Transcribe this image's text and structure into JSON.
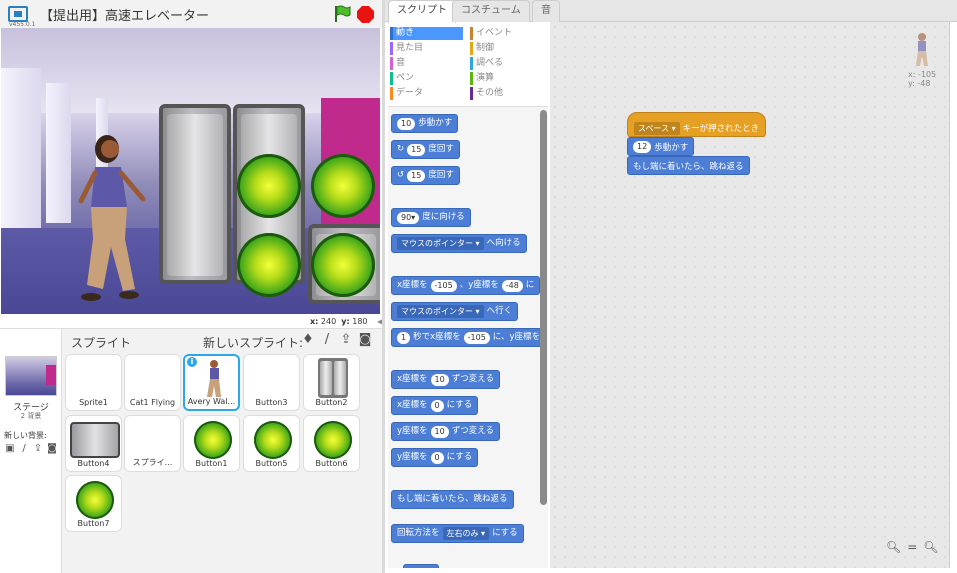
{
  "stage": {
    "version": "v455.0.1",
    "project_title": "【提出用】高速エレベーター",
    "mouse_x_label": "x:",
    "mouse_x": "240",
    "mouse_y_label": "y:",
    "mouse_y": "180"
  },
  "sprites_pane": {
    "header": "スプライト",
    "new_sprite_label": "新しいスプライト:",
    "stage_label": "ステージ",
    "stage_backdrops": "2 背景",
    "new_backdrop_label": "新しい背景:",
    "sprites": [
      {
        "name": "Sprite1",
        "thumb": "empty"
      },
      {
        "name": "Cat1 Flying",
        "thumb": "empty"
      },
      {
        "name": "Avery Wal...",
        "thumb": "character",
        "selected": true
      },
      {
        "name": "Button3",
        "thumb": "empty"
      },
      {
        "name": "Button2",
        "thumb": "door"
      },
      {
        "name": "Button4",
        "thumb": "grey"
      },
      {
        "name": "スプライ...",
        "thumb": "empty"
      },
      {
        "name": "Button1",
        "thumb": "green"
      },
      {
        "name": "Button5",
        "thumb": "green"
      },
      {
        "name": "Button6",
        "thumb": "green"
      },
      {
        "name": "Button7",
        "thumb": "green"
      }
    ]
  },
  "tabs": [
    {
      "label": "スクリプト",
      "active": true
    },
    {
      "label": "コスチューム",
      "active": false
    },
    {
      "label": "音",
      "active": false
    }
  ],
  "categories": [
    {
      "label": "動き",
      "color": "#4c97ff",
      "active": true
    },
    {
      "label": "見た目",
      "color": "#9966ff",
      "active": false
    },
    {
      "label": "音",
      "color": "#cf63cf",
      "active": false
    },
    {
      "label": "ペン",
      "color": "#0fbd8c",
      "active": false
    },
    {
      "label": "データ",
      "color": "#ff8c1a",
      "active": false
    },
    {
      "label": "イベント",
      "color": "#c88330",
      "active": false
    },
    {
      "label": "制御",
      "color": "#e1a91a",
      "active": false
    },
    {
      "label": "調べる",
      "color": "#2ca5e2",
      "active": false
    },
    {
      "label": "演算",
      "color": "#5cb712",
      "active": false
    },
    {
      "label": "その他",
      "color": "#632d99",
      "active": false
    }
  ],
  "palette": {
    "move": {
      "value": "10",
      "text": "歩動かす"
    },
    "turn_right": {
      "value": "15",
      "text": "度回す"
    },
    "turn_left": {
      "value": "15",
      "text": "度回す"
    },
    "point_dir": {
      "value": "90▾",
      "text": "度に向ける"
    },
    "point_towards": {
      "dropdown": "マウスのポインター ▾",
      "text": "へ向ける"
    },
    "goto_xy": {
      "prefix": "x座標を",
      "x": "-105",
      "mid": "、y座標を",
      "y": "-48",
      "suffix": "に"
    },
    "goto": {
      "dropdown": "マウスのポインター ▾",
      "text": "へ行く"
    },
    "glide": {
      "secs": "1",
      "prefix": "秒でx座標を",
      "x": "-105",
      "suffix": "に、y座標を"
    },
    "change_x": {
      "prefix": "x座標を",
      "value": "10",
      "suffix": "ずつ変える"
    },
    "set_x": {
      "prefix": "x座標を",
      "value": "0",
      "suffix": "にする"
    },
    "change_y": {
      "prefix": "y座標を",
      "value": "10",
      "suffix": "ずつ変える"
    },
    "set_y": {
      "prefix": "y座標を",
      "value": "0",
      "suffix": "にする"
    },
    "bounce": {
      "text": "もし端に着いたら、跳ね返る"
    },
    "rotation": {
      "prefix": "回転方法を",
      "dropdown": "左右のみ ▾",
      "suffix": "にする"
    }
  },
  "script": {
    "hat": {
      "key": "スペース ▾",
      "text": "キーが押されたとき"
    },
    "move": {
      "value": "12",
      "text": "歩動かす"
    },
    "bounce": {
      "text": "もし端に着いたら、跳ね返る"
    }
  },
  "sprite_info": {
    "x_label": "x:",
    "x": "-105",
    "y_label": "y:",
    "y": "-48"
  },
  "zoom": {
    "out": "−",
    "reset": "=",
    "in": "+"
  }
}
